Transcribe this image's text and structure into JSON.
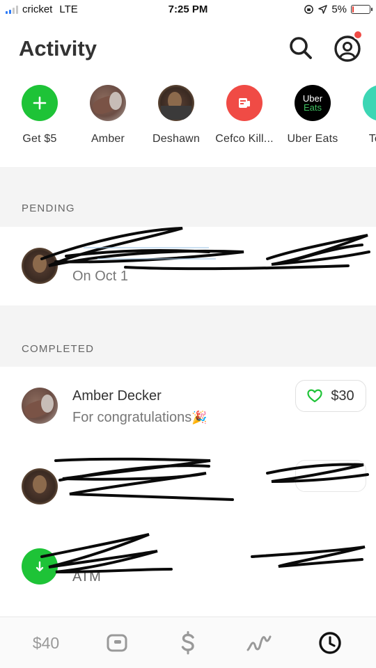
{
  "status_bar": {
    "carrier": "cricket",
    "network": "LTE",
    "time": "7:25 PM",
    "battery": "5%",
    "battery_level": 0.05
  },
  "header": {
    "title": "Activity",
    "search_icon": "search-icon",
    "profile_icon": "profile-icon"
  },
  "contacts": [
    {
      "name": "Get $5",
      "icon": "plus-icon",
      "color": "#1ec337"
    },
    {
      "name": "Amber",
      "icon": "avatar-photo"
    },
    {
      "name": "Deshawn",
      "icon": "avatar-photo"
    },
    {
      "name": "Cefco Kill...",
      "icon": "store-icon",
      "color": "#f04b45"
    },
    {
      "name": "Uber Eats",
      "icon": "uber-eats-logo",
      "logo_line1": "Uber",
      "logo_line2": "Eats",
      "color": "#000000"
    },
    {
      "name": "Texa",
      "icon": "store-icon",
      "color": "#3cd6b4"
    }
  ],
  "sections": {
    "pending_label": "PENDING",
    "completed_label": "COMPLETED"
  },
  "pending": [
    {
      "subtitle": "On Oct 1"
    }
  ],
  "completed": [
    {
      "title": "Amber Decker",
      "subtitle": "For congratulations",
      "emoji": "🎉",
      "amount": "$30",
      "icon": "heart-icon",
      "accent": "#1ec337"
    },
    {
      "title": "",
      "subtitle": ""
    },
    {
      "subtitle": "ATM",
      "icon": "cash-icon",
      "color": "#1ec337"
    }
  ],
  "bottom_nav": {
    "balance": "$40",
    "items": [
      "wallet-icon",
      "dollar-icon",
      "investing-icon",
      "clock-icon"
    ]
  }
}
